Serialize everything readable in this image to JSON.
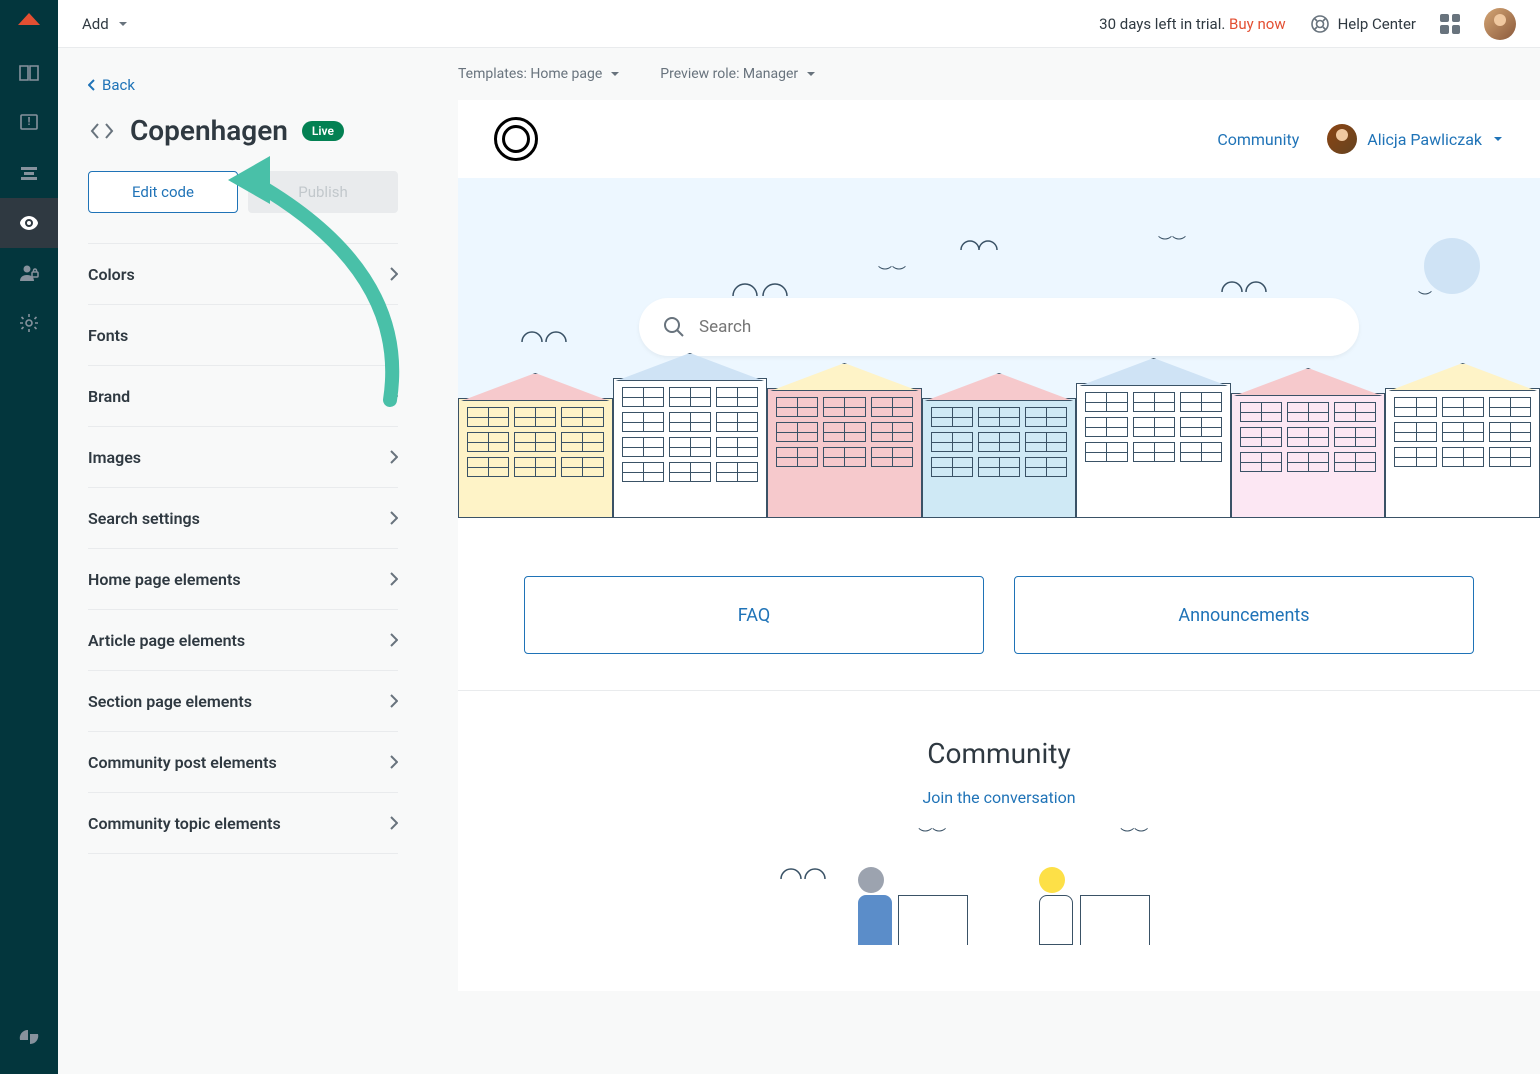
{
  "topbar": {
    "add_label": "Add",
    "trial_text": "30 days left in trial.",
    "buy_now": "Buy now",
    "help_center": "Help Center"
  },
  "sidebar": {
    "back_label": "Back",
    "theme_name": "Copenhagen",
    "live_badge": "Live",
    "edit_code_label": "Edit code",
    "publish_label": "Publish",
    "items": [
      {
        "label": "Colors"
      },
      {
        "label": "Fonts"
      },
      {
        "label": "Brand"
      },
      {
        "label": "Images"
      },
      {
        "label": "Search settings"
      },
      {
        "label": "Home page elements"
      },
      {
        "label": "Article page elements"
      },
      {
        "label": "Section page elements"
      },
      {
        "label": "Community post elements"
      },
      {
        "label": "Community topic elements"
      }
    ]
  },
  "content_header": {
    "templates_label": "Templates: Home page",
    "preview_role_label": "Preview role: Manager"
  },
  "preview": {
    "community_link": "Community",
    "user_name": "Alicja Pawliczak",
    "search_placeholder": "Search",
    "categories": [
      {
        "label": "FAQ"
      },
      {
        "label": "Announcements"
      }
    ],
    "community_title": "Community",
    "join_conversation": "Join the conversation"
  },
  "colors": {
    "accent": "#1f73b7",
    "rail": "#03363d",
    "hero": "#edf7ff",
    "live": "#038153",
    "danger": "#e34f32",
    "annotation": "#49c0a8"
  }
}
